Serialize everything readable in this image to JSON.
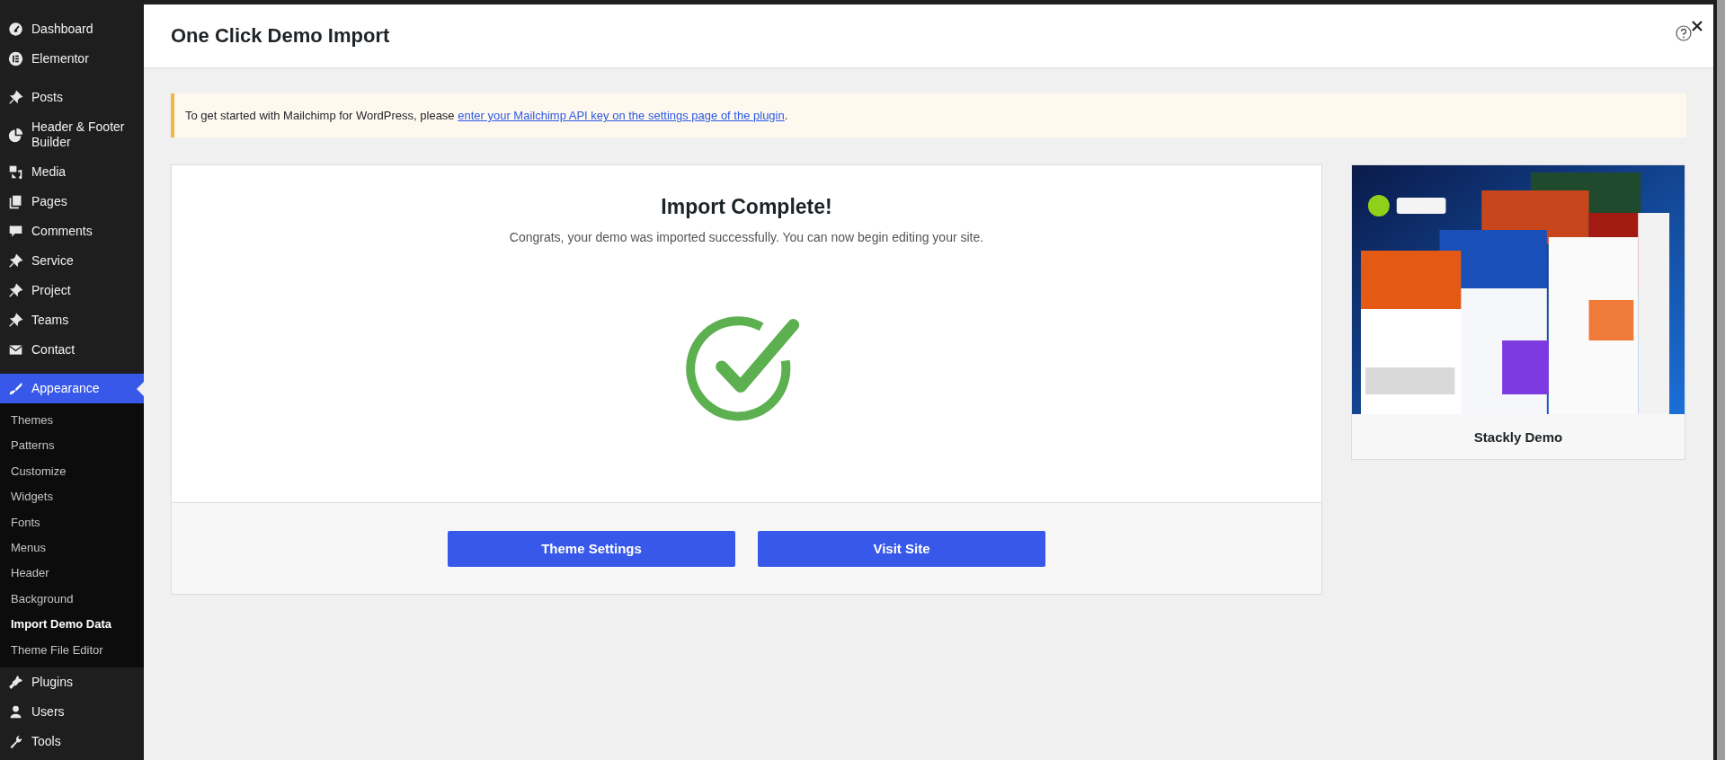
{
  "sidebar": {
    "items": [
      {
        "label": "Dashboard",
        "selected": false
      },
      {
        "label": "Elementor",
        "selected": false
      },
      {
        "kind": "separator"
      },
      {
        "label": "Posts",
        "selected": false
      },
      {
        "label": "Header & Footer Builder",
        "selected": false
      },
      {
        "label": "Media",
        "selected": false
      },
      {
        "label": "Pages",
        "selected": false
      },
      {
        "label": "Comments",
        "selected": false
      },
      {
        "label": "Service",
        "selected": false
      },
      {
        "label": "Project",
        "selected": false
      },
      {
        "label": "Teams",
        "selected": false
      },
      {
        "label": "Contact",
        "selected": false
      },
      {
        "kind": "separator"
      },
      {
        "label": "Appearance",
        "selected": true,
        "children": [
          {
            "label": "Themes",
            "selected": false
          },
          {
            "label": "Patterns",
            "selected": false
          },
          {
            "label": "Customize",
            "selected": false
          },
          {
            "label": "Widgets",
            "selected": false
          },
          {
            "label": "Fonts",
            "selected": false
          },
          {
            "label": "Menus",
            "selected": false
          },
          {
            "label": "Header",
            "selected": false
          },
          {
            "label": "Background",
            "selected": false
          },
          {
            "label": "Import Demo Data",
            "selected": true
          },
          {
            "label": "Theme File Editor",
            "selected": false
          }
        ]
      },
      {
        "label": "Plugins",
        "selected": false
      },
      {
        "label": "Users",
        "selected": false
      },
      {
        "label": "Tools",
        "selected": false
      }
    ]
  },
  "header": {
    "title": "One Click Demo Import"
  },
  "notice": {
    "text": "To get started with Mailchimp for WordPress, please ",
    "link": "enter your Mailchimp API key on the settings page of the plugin",
    "after": "."
  },
  "result": {
    "title": "Import Complete!",
    "message": "Congrats, your demo was imported successfully. You can now begin editing your site.",
    "buttons": [
      "Theme Settings",
      "Visit Site"
    ]
  },
  "preview": {
    "kind": "picture",
    "caption": "Stackly Demo"
  }
}
